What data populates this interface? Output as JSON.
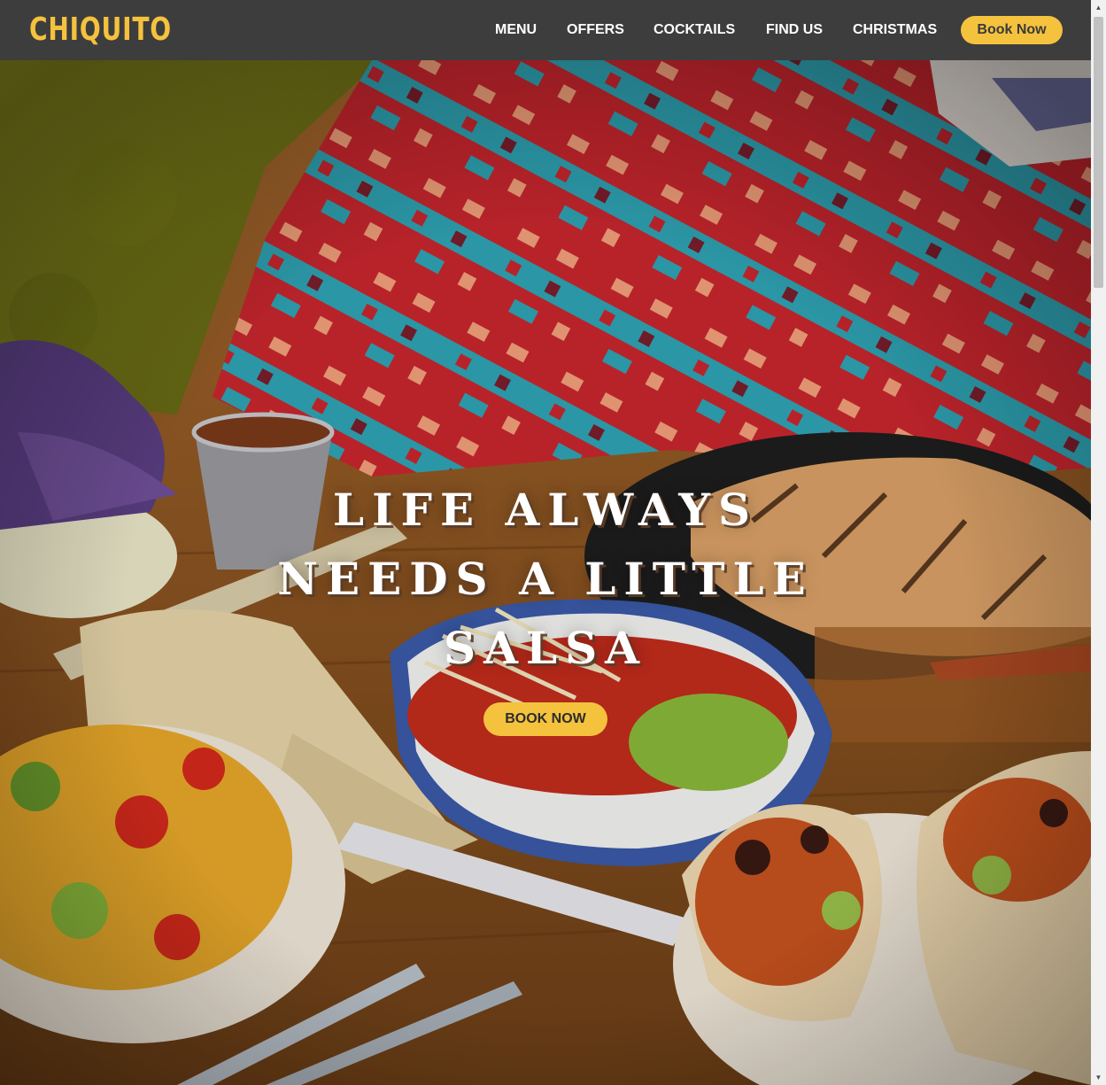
{
  "header": {
    "logo_text": "CHIQUITO",
    "nav": [
      {
        "label": "MENU"
      },
      {
        "label": "OFFERS"
      },
      {
        "label": "COCKTAILS"
      },
      {
        "label": "FIND US"
      },
      {
        "label": "CHRISTMAS"
      }
    ],
    "book_label": "Book Now"
  },
  "hero": {
    "headline_lines": [
      "LIFE ALWAYS",
      "NEEDS A LITTLE",
      "SALSA"
    ],
    "cta_label": "BOOK NOW"
  },
  "colors": {
    "brand_yellow": "#f5c23e",
    "header_bg": "#3d3d3d"
  }
}
